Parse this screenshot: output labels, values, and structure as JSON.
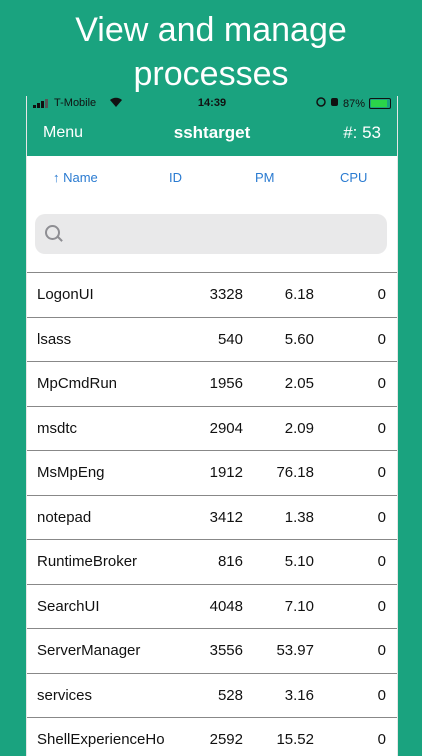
{
  "promo": {
    "line1": "View and manage",
    "line2": "processes"
  },
  "status_bar": {
    "carrier": "T-Mobile",
    "time": "14:39",
    "battery": "87%"
  },
  "nav": {
    "menu_label": "Menu",
    "title": "sshtarget",
    "count_label": "#: 53"
  },
  "columns": {
    "name": "↑ Name",
    "id": "ID",
    "pm": "PM",
    "cpu": "CPU"
  },
  "search": {
    "placeholder": ""
  },
  "processes": [
    {
      "name": "LogonUI",
      "id": "3328",
      "pm": "6.18",
      "cpu": "0"
    },
    {
      "name": "lsass",
      "id": "540",
      "pm": "5.60",
      "cpu": "0"
    },
    {
      "name": "MpCmdRun",
      "id": "1956",
      "pm": "2.05",
      "cpu": "0"
    },
    {
      "name": "msdtc",
      "id": "2904",
      "pm": "2.09",
      "cpu": "0"
    },
    {
      "name": "MsMpEng",
      "id": "1912",
      "pm": "76.18",
      "cpu": "0"
    },
    {
      "name": "notepad",
      "id": "3412",
      "pm": "1.38",
      "cpu": "0"
    },
    {
      "name": "RuntimeBroker",
      "id": "816",
      "pm": "5.10",
      "cpu": "0"
    },
    {
      "name": "SearchUI",
      "id": "4048",
      "pm": "7.10",
      "cpu": "0"
    },
    {
      "name": "ServerManager",
      "id": "3556",
      "pm": "53.97",
      "cpu": "0"
    },
    {
      "name": "services",
      "id": "528",
      "pm": "3.16",
      "cpu": "0"
    },
    {
      "name": "ShellExperienceHo",
      "id": "2592",
      "pm": "15.52",
      "cpu": "0"
    }
  ],
  "colors": {
    "accent": "#1aa37f",
    "link": "#2a7bd1"
  }
}
